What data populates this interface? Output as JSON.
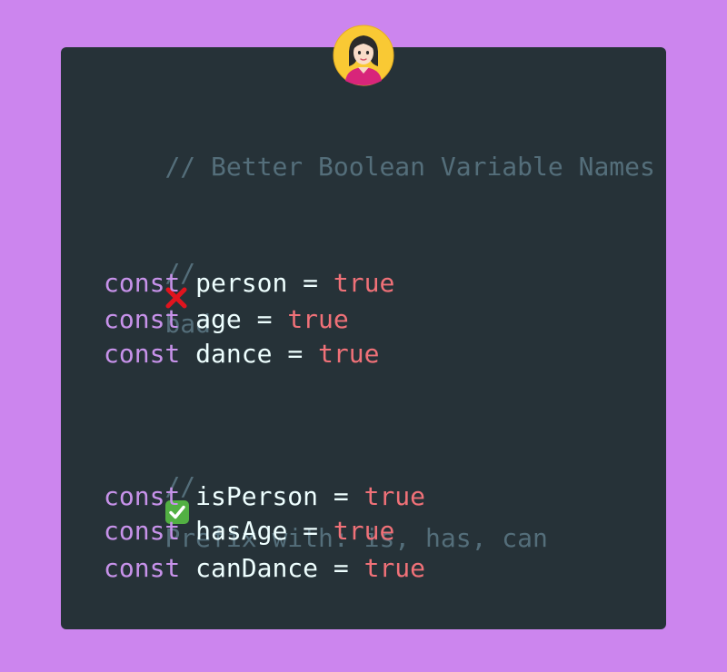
{
  "title_comment": "// Better Boolean Variable Names",
  "bad_block": {
    "comment_prefix": "//",
    "comment_text": "bad",
    "icon": "cross-mark-icon",
    "lines": [
      {
        "keyword": "const",
        "name": "person",
        "op": "=",
        "value": "true"
      },
      {
        "keyword": "const",
        "name": "age",
        "op": "=",
        "value": "true"
      },
      {
        "keyword": "const",
        "name": "dance",
        "op": "=",
        "value": "true"
      }
    ]
  },
  "good_block": {
    "comment_prefix": "//",
    "comment_text": "Prefix with: is, has, can",
    "icon": "check-mark-button-icon",
    "lines": [
      {
        "keyword": "const",
        "name": "isPerson",
        "op": "=",
        "value": "true"
      },
      {
        "keyword": "const",
        "name": "hasAge",
        "op": "=",
        "value": "true"
      },
      {
        "keyword": "const",
        "name": "canDance",
        "op": "=",
        "value": "true"
      }
    ]
  },
  "colors": {
    "background": "#cc85ee",
    "card": "#263238",
    "comment": "#546e7a",
    "keyword": "#c792ea",
    "identifier": "#eeffff",
    "literal": "#f07178"
  },
  "avatar_icon": "woman-avatar-icon"
}
